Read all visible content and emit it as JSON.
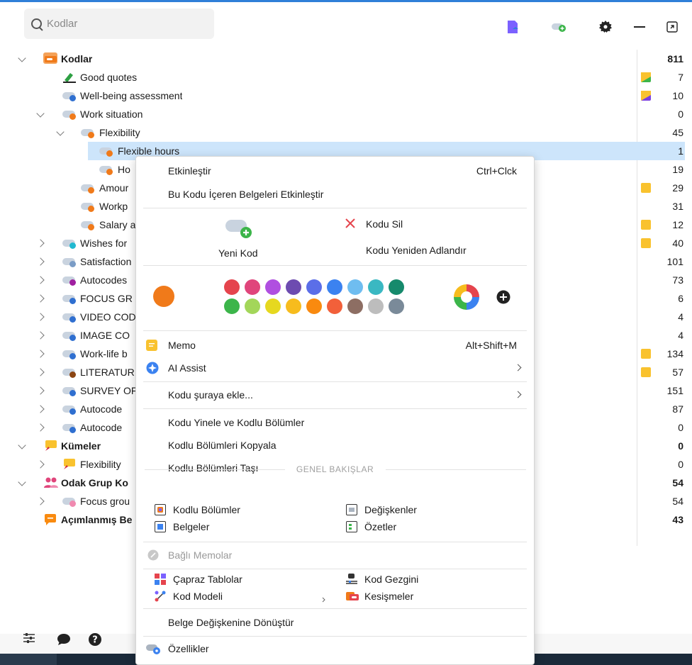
{
  "search": {
    "placeholder": "Kodlar"
  },
  "colors": {
    "accent": "#2f7fd8",
    "selection": "#cde5fb",
    "orange": "#f07a1a",
    "memo_yellow": "#f9c22e"
  },
  "tree": {
    "rows": [
      {
        "label": "Kodlar",
        "count": "811",
        "bold": true
      },
      {
        "label": "Good quotes",
        "count": "7"
      },
      {
        "label": "Well-being assessment",
        "count": "10"
      },
      {
        "label": "Work situation",
        "count": "0"
      },
      {
        "label": "Flexibility",
        "count": "45"
      },
      {
        "label": "Flexible hours",
        "count": "1"
      },
      {
        "label": "Ho",
        "count": "19"
      },
      {
        "label": "Amour",
        "count": "29"
      },
      {
        "label": "Workp",
        "count": "31"
      },
      {
        "label": "Salary a",
        "count": "12"
      },
      {
        "label": "Wishes for",
        "count": "40"
      },
      {
        "label": "Satisfaction",
        "count": "101"
      },
      {
        "label": "Autocodes",
        "count": "73"
      },
      {
        "label": "FOCUS GR",
        "count": "6"
      },
      {
        "label": "VIDEO COD",
        "count": "4"
      },
      {
        "label": "IMAGE CO",
        "count": "4"
      },
      {
        "label": "Work-life b",
        "count": "134"
      },
      {
        "label": "LITERATUR",
        "count": "57"
      },
      {
        "label": "SURVEY OF",
        "count": "151"
      },
      {
        "label": "Autocode",
        "count": "87"
      },
      {
        "label": "Autocode",
        "count": "0"
      },
      {
        "label": "Kümeler",
        "count": "0",
        "bold": true
      },
      {
        "label": "Flexibility",
        "count": "0"
      },
      {
        "label": "Odak Grup Ko",
        "count": "54",
        "bold": true
      },
      {
        "label": "Focus grou",
        "count": "54"
      },
      {
        "label": "Açımlanmış Be",
        "count": "43",
        "bold": true
      }
    ]
  },
  "menu": {
    "activate": "Etkinleştir",
    "activate_shortcut": "Ctrl+Clck",
    "activate_docs": "Bu Kodu İçeren Belgeleri Etkinleştir",
    "new_code": "Yeni Kod",
    "delete_code": "Kodu Sil",
    "rename_code": "Kodu Yeniden Adlandır",
    "memo": "Memo",
    "memo_shortcut": "Alt+Shift+M",
    "ai_assist": "AI Assist",
    "add_code_to": "Kodu şuraya ekle...",
    "recode": "Kodu Yinele ve Kodlu Bölümler",
    "copy_segments": "Kodlu Bölümleri Kopyala",
    "move_segments": "Kodlu Bölümleri Taşı",
    "overview_title": "GENEL BAKIŞLAR",
    "coded_segments": "Kodlu Bölümler",
    "variables": "Değişkenler",
    "documents": "Belgeler",
    "summaries": "Özetler",
    "linked_memos": "Bağlı Memolar",
    "crosstabs": "Çapraz Tablolar",
    "code_explorer": "Kod Gezgini",
    "code_model": "Kod Modeli",
    "intersections": "Kesişmeler",
    "convert_variable": "Belge Değişkenine Dönüştür",
    "properties": "Özellikler",
    "palette_row1": [
      "#e5444d",
      "#e0457b",
      "#b04fe0",
      "#6d4bb0",
      "#5b6ee8",
      "#3b82f0",
      "#6fbdf0",
      "#3ab8c2",
      "#168a6c"
    ],
    "palette_row2": [
      "#3cb54a",
      "#a3d65a",
      "#e6d81f",
      "#f7bc1d",
      "#f98a0f",
      "#f2603a",
      "#8d6e63",
      "#bdbdbd",
      "#7a8a99"
    ],
    "current_color": "#f07a1a"
  }
}
